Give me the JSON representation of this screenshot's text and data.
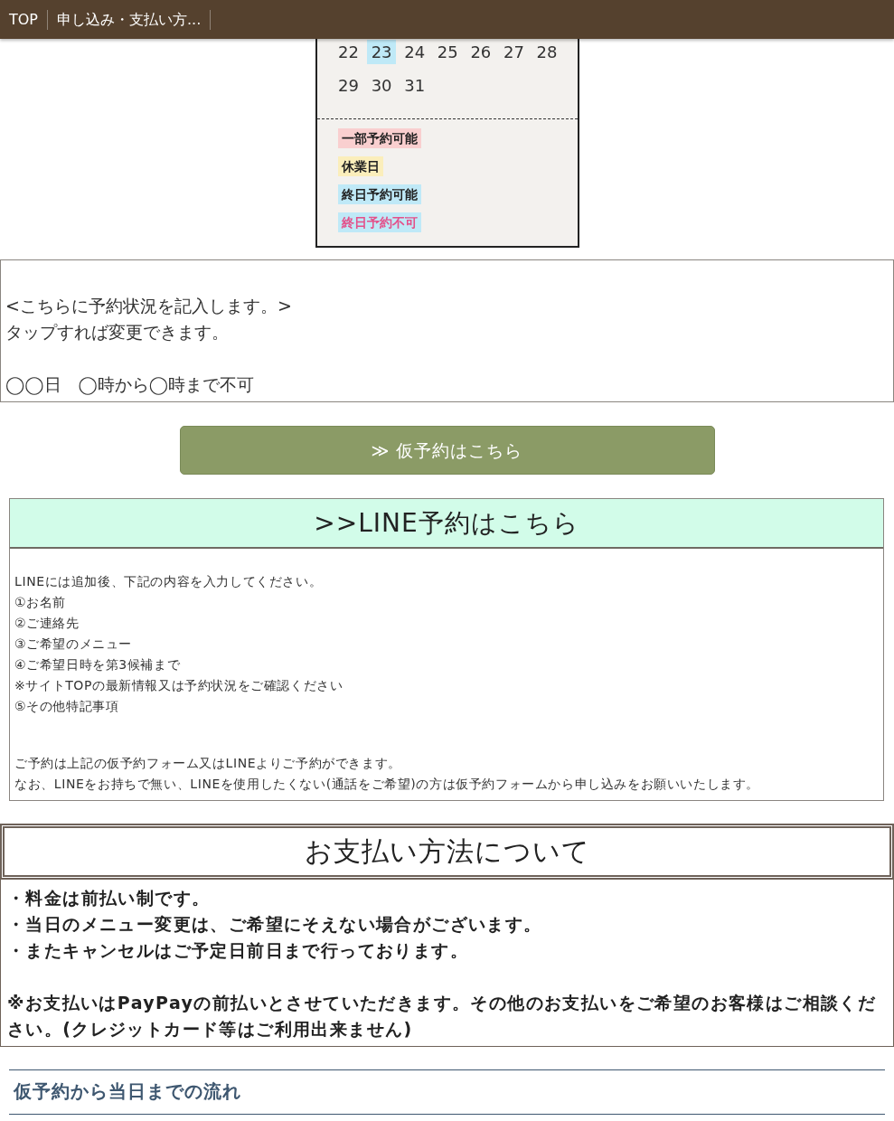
{
  "navbar": {
    "links": [
      {
        "label": "TOP"
      },
      {
        "label": "申し込み・支払い方..."
      }
    ]
  },
  "calendar": {
    "weeks": [
      [
        {
          "day": "22",
          "highlighted": false
        },
        {
          "day": "23",
          "highlighted": true
        },
        {
          "day": "24",
          "highlighted": false
        },
        {
          "day": "25",
          "highlighted": false
        },
        {
          "day": "26",
          "highlighted": false
        },
        {
          "day": "27",
          "highlighted": false
        },
        {
          "day": "28",
          "highlighted": false
        }
      ],
      [
        {
          "day": "29",
          "highlighted": false
        },
        {
          "day": "30",
          "highlighted": false
        },
        {
          "day": "31",
          "highlighted": false
        }
      ]
    ],
    "legend": [
      {
        "label": "一部予約可能",
        "color": "#f9cfcf",
        "kind": "partial"
      },
      {
        "label": "休業日",
        "color": "#fbeebb",
        "kind": "closed"
      },
      {
        "label": "終日予約可能",
        "color": "#bfe9f7",
        "kind": "open"
      },
      {
        "label": "終日予約不可",
        "color": "#bfe9f7",
        "kind": "full"
      }
    ]
  },
  "status_note": {
    "paragraphs": [
      [
        "<こちらに予約状況を記入します。>",
        "タップすれば変更できます。"
      ],
      [
        "◯◯日　◯時から◯時まで不可"
      ]
    ]
  },
  "reserve_button": {
    "label": "≫ 仮予約はこちら"
  },
  "line_section": {
    "title": ">>LINE予約はこちら",
    "paragraphs": [
      [
        "LINEには追加後、下記の内容を入力してください。",
        "①お名前",
        "②ご連絡先",
        "③ご希望のメニュー",
        "④ご希望日時を第3候補まで",
        "※サイトTOPの最新情報又は予約状況をご確認ください",
        "⑤その他特記事項"
      ],
      [
        "ご予約は上記の仮予約フォーム又はLINEよりご予約ができます。",
        "なお、LINEをお持ちで無い、LINEを使用したくない(通話をご希望)の方は仮予約フォームから申し込みをお願いいたします。"
      ]
    ]
  },
  "payment_section": {
    "title": "お支払い方法について",
    "paragraphs": [
      [
        "・料金は前払い制です。",
        "・当日のメニュー変更は、ご希望にそえない場合がございます。",
        "・またキャンセルはご予定日前日まで行っております。"
      ],
      [
        "※お支払いはPayPayの前払いとさせていただきます。その他のお支払いをご希望のお客様はご相談ください。(クレジットカード等はご利用出来ません)"
      ]
    ]
  },
  "next_heading": {
    "title": "仮予約から当日までの流れ"
  }
}
